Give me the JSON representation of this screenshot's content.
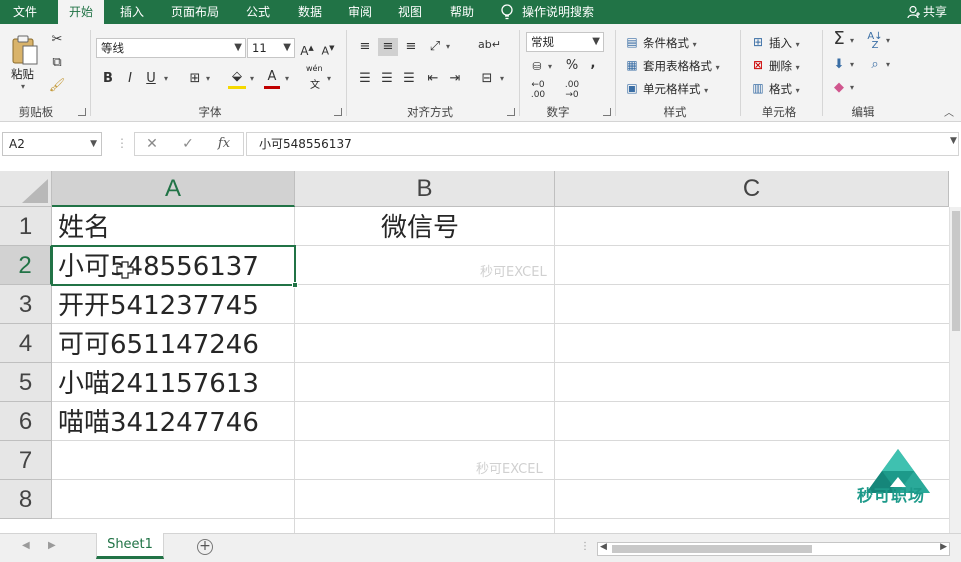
{
  "menu": {
    "items": [
      "文件",
      "开始",
      "插入",
      "页面布局",
      "公式",
      "数据",
      "审阅",
      "视图",
      "帮助"
    ],
    "active": "开始",
    "tell_me": "操作说明搜索",
    "share": "共享"
  },
  "ribbon": {
    "clipboard": {
      "paste": "粘贴",
      "label": "剪贴板"
    },
    "font": {
      "name": "等线",
      "size": "11",
      "label": "字体",
      "bold": "B",
      "italic": "I",
      "underline": "U",
      "wen": "wén",
      "wen_char": "文"
    },
    "alignment": {
      "label": "对齐方式"
    },
    "number": {
      "format": "常规",
      "label": "数字",
      "percent": "%",
      "comma": ","
    },
    "styles": {
      "conditional": "条件格式",
      "table": "套用表格格式",
      "cell_styles": "单元格样式",
      "label": "样式"
    },
    "cells": {
      "insert": "插入",
      "delete": "删除",
      "format": "格式",
      "label": "单元格"
    },
    "editing": {
      "label": "编辑"
    }
  },
  "formula_bar": {
    "name_box": "A2",
    "content": "小可548556137"
  },
  "grid": {
    "columns": [
      "A",
      "B",
      "C"
    ],
    "rows": [
      "1",
      "2",
      "3",
      "4",
      "5",
      "6",
      "7",
      "8"
    ],
    "selected_cell": "A2",
    "cells": {
      "a1": "姓名",
      "b1": "微信号",
      "a2": "小可548556137",
      "a3": "开开541237745",
      "a4": "可可651147246",
      "a5": "小喵241157613",
      "a6": "喵喵341247746"
    },
    "watermark": "秒可EXCEL"
  },
  "logo": {
    "text": "秒可职场"
  },
  "sheets": {
    "tabs": [
      "Sheet1"
    ],
    "active": "Sheet1"
  },
  "colors": {
    "accent": "#217346",
    "logo": "#1d9a8a"
  }
}
